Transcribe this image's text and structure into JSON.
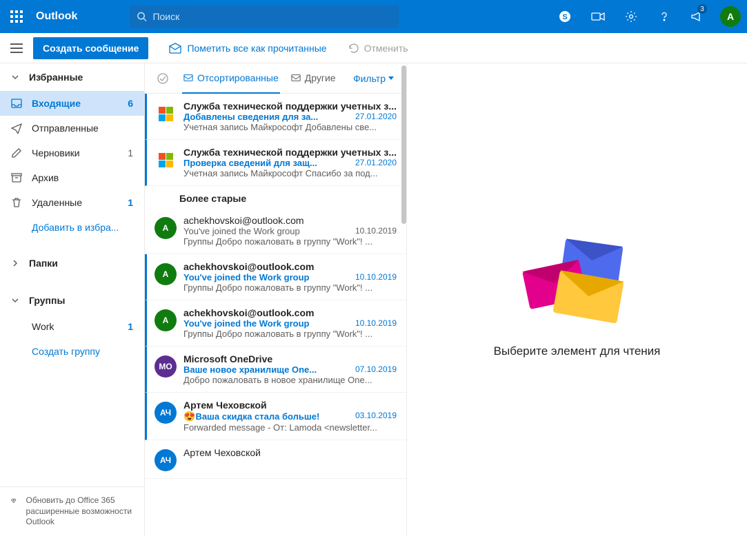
{
  "header": {
    "app_name": "Outlook",
    "search_placeholder": "Поиск",
    "notif_count": "3",
    "avatar_initial": "A"
  },
  "toolbar": {
    "compose": "Создать сообщение",
    "mark_all_read": "Пометить все как прочитанные",
    "undo": "Отменить"
  },
  "sidebar": {
    "favorites_head": "Избранные",
    "folders_head": "Папки",
    "groups_head": "Группы",
    "items": [
      {
        "label": "Входящие",
        "count": "6"
      },
      {
        "label": "Отправленные"
      },
      {
        "label": "Черновики",
        "count": "1"
      },
      {
        "label": "Архив"
      },
      {
        "label": "Удаленные",
        "count": "1"
      }
    ],
    "add_favorite": "Добавить в избра...",
    "group_work": {
      "label": "Work",
      "count": "1"
    },
    "create_group": "Создать группу",
    "upgrade": "Обновить до Office 365 расширенные возможности Outlook"
  },
  "listhead": {
    "tab_focused": "Отсортированные",
    "tab_other": "Другие",
    "filter": "Фильтр"
  },
  "group_older": "Более старые",
  "messages": [
    {
      "avatar": "ms",
      "from": "Служба технической поддержки учетных з...",
      "subject": "Добавлены сведения для за...",
      "date": "27.01.2020",
      "preview": "Учетная запись Майкрософт Добавлены све...",
      "unread": true
    },
    {
      "avatar": "ms",
      "from": "Служба технической поддержки учетных з...",
      "subject": "Проверка сведений для защ...",
      "date": "27.01.2020",
      "preview": "Учетная запись Майкрософт Спасибо за под...",
      "unread": true
    },
    {
      "avatar": "A",
      "avatar_bg": "#107c10",
      "from": "achekhovskoi@outlook.com",
      "subject": "You've joined the Work group",
      "date": "10.10.2019",
      "preview": "Группы Добро пожаловать в группу \"Work\"! ...",
      "unread": false
    },
    {
      "avatar": "A",
      "avatar_bg": "#107c10",
      "from": "achekhovskoi@outlook.com",
      "subject": "You've joined the Work group",
      "date": "10.10.2019",
      "preview": "Группы Добро пожаловать в группу \"Work\"! ...",
      "unread": true
    },
    {
      "avatar": "A",
      "avatar_bg": "#107c10",
      "from": "achekhovskoi@outlook.com",
      "subject": "You've joined the Work group",
      "date": "10.10.2019",
      "preview": "Группы Добро пожаловать в группу \"Work\"! ...",
      "unread": true
    },
    {
      "avatar": "МО",
      "avatar_bg": "#5c2e91",
      "from": "Microsoft OneDrive",
      "subject": "Ваше новое хранилище One...",
      "date": "07.10.2019",
      "preview": "Добро пожаловать в новое хранилище One...",
      "unread": true
    },
    {
      "avatar": "АЧ",
      "avatar_bg": "#0078d4",
      "from": "Артем Чеховской",
      "subject": "Ваша скидка стала больше!",
      "subject_emoji": "😍",
      "date": "03.10.2019",
      "preview": "Forwarded message - От: Lamoda <newsletter...",
      "unread": true
    },
    {
      "avatar": "АЧ",
      "avatar_bg": "#0078d4",
      "from": "Артем Чеховской",
      "subject": "",
      "date": "",
      "preview": "",
      "unread": false
    }
  ],
  "reading": {
    "hint": "Выберите элемент для чтения"
  }
}
